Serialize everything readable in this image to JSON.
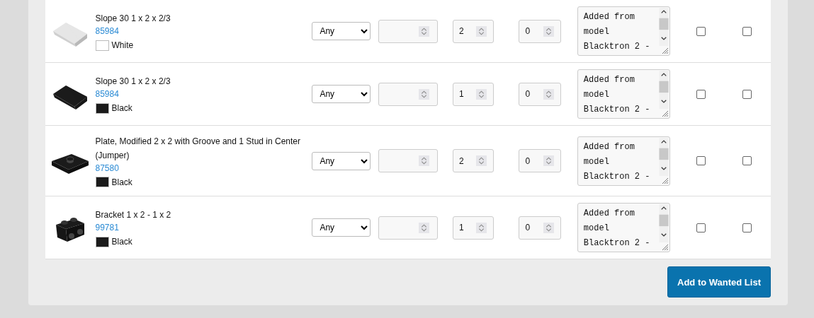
{
  "rows": [
    {
      "name": "Slope 30 1 x 2 x 2/3",
      "part_number": "85984",
      "kind": "slope",
      "color": "#ffffff",
      "color_name": "White",
      "column_3": "Any",
      "column_5": "2",
      "column_6": "0",
      "column_7": "Added from model Blacktron 2 -",
      "column_8_checked": false,
      "column_9_checked": false
    },
    {
      "name": "Slope 30 1 x 2 x 2/3",
      "part_number": "85984",
      "kind": "slope",
      "color": "#1b1b1b",
      "color_name": "Black",
      "column_3": "Any",
      "column_5": "1",
      "column_6": "0",
      "column_7": "Added from model Blacktron 2 -",
      "column_8_checked": false,
      "column_9_checked": false
    },
    {
      "name": "Plate, Modified 2 x 2 with Groove and 1 Stud in Center (Jumper)",
      "part_number": "87580",
      "kind": "plate",
      "color": "#1b1b1b",
      "color_name": "Black",
      "column_3": "Any",
      "column_5": "2",
      "column_6": "0",
      "column_7": "Added from model Blacktron 2 -",
      "column_8_checked": false,
      "column_9_checked": false
    },
    {
      "name": "Bracket 1 x 2 - 1 x 2",
      "part_number": "99781",
      "kind": "bracket",
      "color": "#1b1b1b",
      "color_name": "Black",
      "column_3": "Any",
      "column_5": "1",
      "column_6": "0",
      "column_7": "Added from model Blacktron 2 -",
      "column_8_checked": false,
      "column_9_checked": false
    }
  ],
  "button": "Add to Wanted List"
}
